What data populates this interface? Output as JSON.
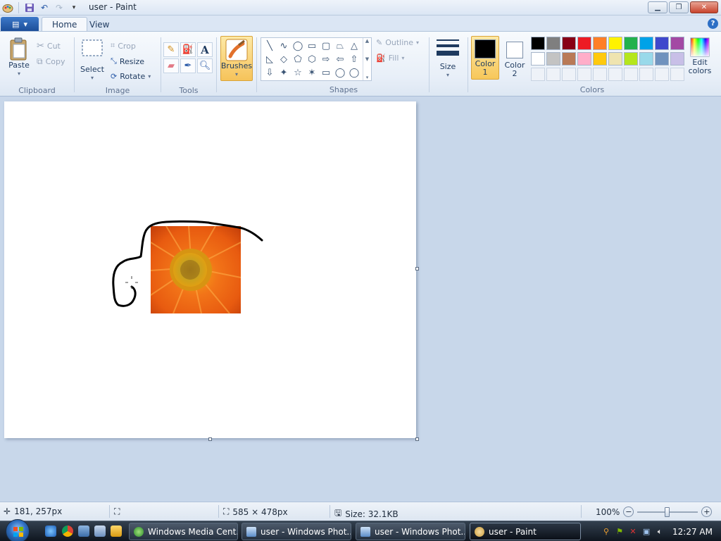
{
  "window": {
    "title": "user - Paint"
  },
  "tabs": [
    {
      "label": "Home",
      "active": true
    },
    {
      "label": "View",
      "active": false
    }
  ],
  "ribbon": {
    "clipboard": {
      "label": "Clipboard",
      "paste": "Paste",
      "cut": "Cut",
      "copy": "Copy"
    },
    "image": {
      "label": "Image",
      "select": "Select",
      "crop": "Crop",
      "resize": "Resize",
      "rotate": "Rotate"
    },
    "tools": {
      "label": "Tools",
      "items": [
        "pencil-icon",
        "fill-icon",
        "text-icon",
        "eraser-icon",
        "color-picker-icon",
        "magnifier-icon"
      ],
      "text_glyph": "A"
    },
    "brushes": {
      "label": "Brushes"
    },
    "shapes": {
      "label": "Shapes",
      "outline": "Outline",
      "fill": "Fill",
      "glyphs": [
        "╲",
        "∿",
        "◯",
        "▭",
        "▢",
        "⏢",
        "△",
        "◺",
        "◇",
        "⬠",
        "⬡",
        "⇨",
        "⇦",
        "⇧",
        "⇩",
        "✦",
        "☆",
        "✶",
        "▭",
        "◯",
        "◯"
      ]
    },
    "size": {
      "label": "Size"
    },
    "color1": {
      "line1": "Color",
      "line2": "1",
      "color": "#000000"
    },
    "color2": {
      "line1": "Color",
      "line2": "2",
      "color": "#ffffff"
    },
    "edit_colors": {
      "line1": "Edit",
      "line2": "colors"
    },
    "colors_label": "Colors",
    "palette": [
      "#000000",
      "#7f7f7f",
      "#880015",
      "#ed1c24",
      "#ff7f27",
      "#fff200",
      "#22b14c",
      "#00a2e8",
      "#3f48cc",
      "#a349a4",
      "#ffffff",
      "#c3c3c3",
      "#b97a57",
      "#ffaec9",
      "#ffc90e",
      "#efe4b0",
      "#b5e61d",
      "#99d9ea",
      "#7092be",
      "#c8bfe7",
      "",
      "",
      "",
      "",
      "",
      "",
      "",
      "",
      "",
      ""
    ]
  },
  "status": {
    "cursor": "181, 257px",
    "canvas_size": "585 × 478px",
    "file_size": "Size: 32.1KB",
    "zoom": "100%"
  },
  "taskbar": {
    "tasks": [
      {
        "label": "Windows Media Cent...",
        "active": false
      },
      {
        "label": "user - Windows Phot...",
        "active": false
      },
      {
        "label": "user - Windows Phot...",
        "active": false
      },
      {
        "label": "user - Paint",
        "active": true
      }
    ],
    "time": "12:27 AM"
  }
}
